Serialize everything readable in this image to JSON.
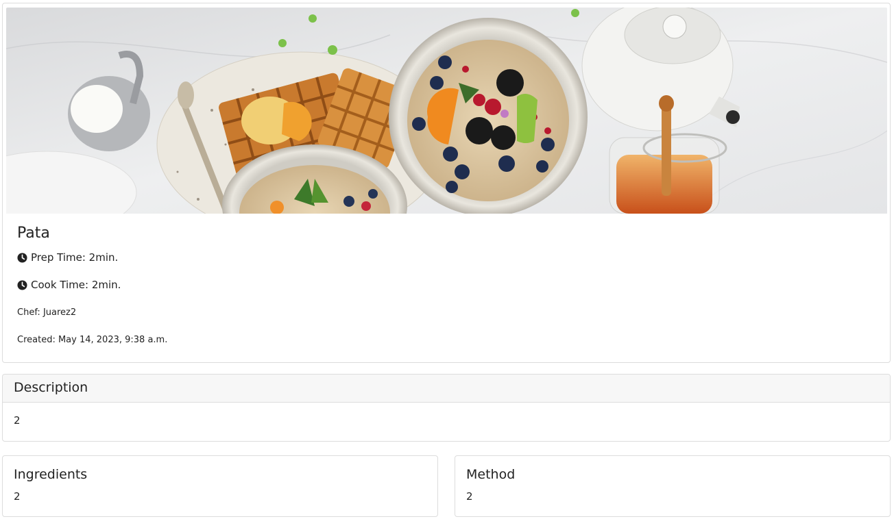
{
  "recipe": {
    "title": "Pata",
    "prep_time": "Prep Time: 2min.",
    "cook_time": "Cook Time: 2min.",
    "chef": "Chef: Juarez2",
    "created": "Created: May 14, 2023, 9:38 a.m.",
    "image_alt": "Breakfast table with waffles, fruit oatmeal bowls, milk jug, teapot and honey jar",
    "clock_icon": "clock-icon"
  },
  "description": {
    "header": "Description",
    "body": "2"
  },
  "ingredients": {
    "header": "Ingredients",
    "body": "2"
  },
  "method": {
    "header": "Method",
    "body": "2"
  },
  "colors": {
    "border": "#dcdcdc",
    "header_bg": "#f7f7f7",
    "text": "#222222"
  }
}
